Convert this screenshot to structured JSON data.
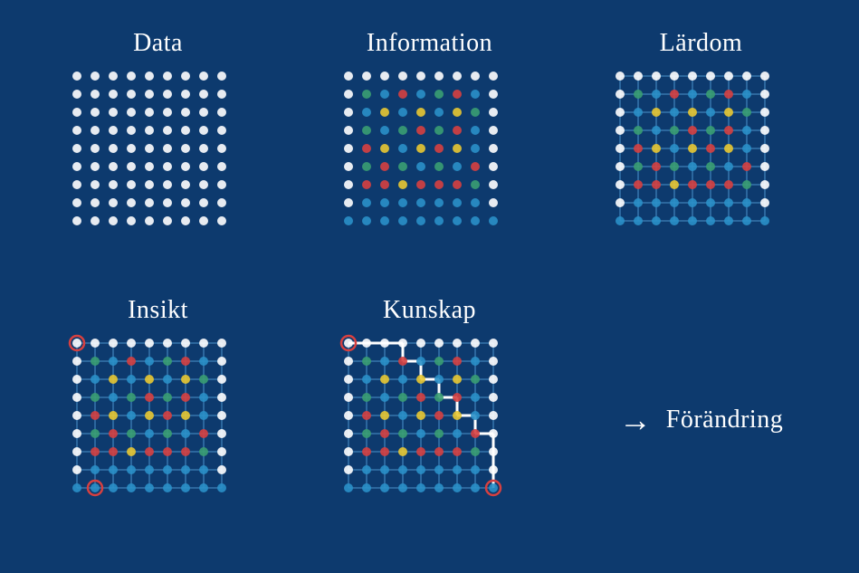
{
  "cells": [
    {
      "id": "data",
      "title": "Data",
      "type": "plain_dots"
    },
    {
      "id": "information",
      "title": "Information",
      "type": "colored_dots"
    },
    {
      "id": "lardom",
      "title": "Lärdom",
      "type": "connected_colored"
    },
    {
      "id": "insikt",
      "title": "Insikt",
      "type": "connected_highlighted"
    },
    {
      "id": "kunskap",
      "title": "Kunskap",
      "type": "connected_path"
    },
    {
      "id": "forandring",
      "title": "Förändring",
      "type": "text_only"
    }
  ],
  "colors": {
    "background": "#0d3a6e",
    "white": "#ffffff",
    "green": "#3a9a6e",
    "teal": "#2a7fad",
    "red": "#d94040",
    "yellow": "#e8c832",
    "line_color": "#4a90c8"
  }
}
